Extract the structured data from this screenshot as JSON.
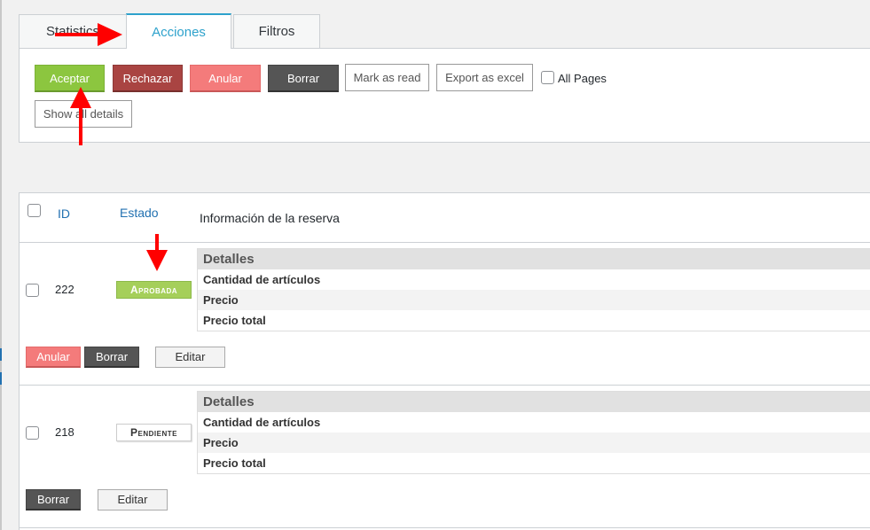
{
  "tabs": [
    {
      "label": "Statistics"
    },
    {
      "label": "Acciones"
    },
    {
      "label": "Filtros"
    }
  ],
  "actions": {
    "aceptar": "Aceptar",
    "rechazar": "Rechazar",
    "anular": "Anular",
    "borrar": "Borrar",
    "mark_read": "Mark as read",
    "export_excel": "Export as excel",
    "all_pages": "All Pages",
    "show_details": "Show all details"
  },
  "table": {
    "col_id": "ID",
    "col_estado": "Estado",
    "col_info": "Información de la reserva",
    "rows": [
      {
        "id": "222",
        "estado": "Aprobada",
        "details_title": "Detalles",
        "f1": "Cantidad de artículos",
        "f2": "Precio",
        "f3": "Precio total",
        "btn_anular": "Anular",
        "btn_borrar": "Borrar",
        "btn_editar": "Editar"
      },
      {
        "id": "218",
        "estado": "Pendiente",
        "details_title": "Detalles",
        "f1": "Cantidad de artículos",
        "f2": "Precio",
        "f3": "Precio total",
        "btn_borrar": "Borrar",
        "btn_editar": "Editar"
      }
    ]
  },
  "colors": {
    "accent": "#2ea2cc",
    "approve": "#8cc63f",
    "reject": "#a94442",
    "cancel": "#f47b7b",
    "delete": "#555555",
    "annotation_arrow": "#ff0000"
  },
  "annotations": [
    "red-arrow",
    "red-arrow",
    "red-arrow"
  ]
}
